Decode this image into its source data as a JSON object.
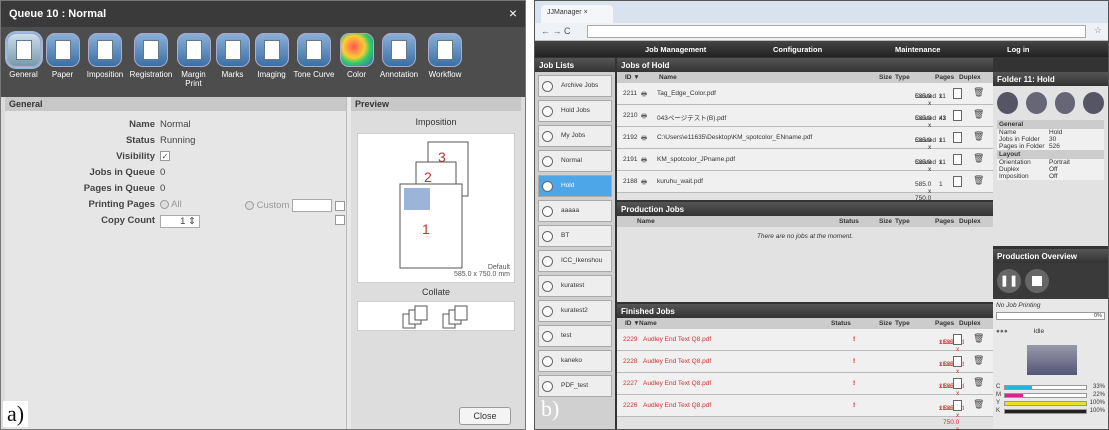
{
  "labels": {
    "a": "a)",
    "b": "b)"
  },
  "dialog": {
    "title": "Queue 10 : Normal",
    "close_x": "×",
    "tools": [
      "General",
      "Paper",
      "Imposition",
      "Registration",
      "Margin Print",
      "Marks",
      "Imaging",
      "Tone Curve",
      "Color",
      "Annotation",
      "Workflow"
    ],
    "general_header": "General",
    "preview_header": "Preview",
    "fields": [
      {
        "k": "Name",
        "v": "Normal"
      },
      {
        "k": "Status",
        "v": "Running"
      },
      {
        "k": "Visibility",
        "v": ""
      },
      {
        "k": "Jobs in Queue",
        "v": "0"
      },
      {
        "k": "Pages in Queue",
        "v": "0"
      },
      {
        "k": "Printing Pages",
        "v": "All"
      },
      {
        "k": "Copy Count",
        "v": "1"
      }
    ],
    "custom_label": "Custom",
    "imposition_label": "Imposition",
    "default_label": "Default",
    "size_label": "585.0 x 750.0 mm",
    "collate_label": "Collate",
    "close_button": "Close"
  },
  "app": {
    "tab_title": "JJManager",
    "nav": [
      "Job Management",
      "Configuration",
      "Maintenance",
      "Log in"
    ],
    "job_lists_header": "Job Lists",
    "job_lists": [
      "Archive Jobs",
      "Hold Jobs",
      "My Jobs",
      "Normal",
      "Hold",
      "aaaaa",
      "BT",
      "ICC_Ikenshou",
      "kuratest",
      "kuratest2",
      "test",
      "kaneko",
      "PDF_test"
    ],
    "hold_header": "Jobs of Hold",
    "hold_cols": [
      "ID ▼",
      "Name",
      "Size",
      "Type",
      "Pages",
      "Duplex"
    ],
    "hold_rows": [
      {
        "id": "2211",
        "name": "Tag_Edge_Color.pdf",
        "size": "585.0 x 750.0 x 0.13",
        "type": "Coated",
        "pages": "1",
        "copies": "x1"
      },
      {
        "id": "2210",
        "name": "043ページテスト(B).pdf",
        "size": "585.0 x 750.0 x 0.13",
        "type": "Coated",
        "pages": "43",
        "copies": "x1"
      },
      {
        "id": "2192",
        "name": "C:\\Users\\e11635\\Desktop\\KM_spotcolor_ENname.pdf",
        "size": "585.0 x 750.0 x 0.13",
        "type": "Coated",
        "pages": "1",
        "copies": "x1"
      },
      {
        "id": "2191",
        "name": "KM_spotcolor_JPname.pdf",
        "size": "585.0 x 750.0 x 0.10",
        "type": "Coated",
        "pages": "1",
        "copies": "x1"
      },
      {
        "id": "2188",
        "name": "kuruhu_wait.pdf",
        "size": "585.0 x 750.0 x 0.13",
        "type": "",
        "pages": "1",
        "copies": ""
      }
    ],
    "prod_header": "Production Jobs",
    "prod_cols": [
      "Name",
      "Status",
      "Size",
      "Type",
      "Pages",
      "Duplex"
    ],
    "prod_empty": "There are no jobs at the moment.",
    "fin_header": "Finished Jobs",
    "fin_cols": [
      "ID ▼",
      "Name",
      "Status",
      "Size",
      "Type",
      "Pages",
      "Duplex"
    ],
    "fin_rows": [
      {
        "id": "2229",
        "name": "Audley End Text Q8.pdf",
        "size": "585.0 x 750.0 x 0.10",
        "type": "Coated",
        "pages": "1",
        "copies": "x1"
      },
      {
        "id": "2228",
        "name": "Audley End Text Q8.pdf",
        "size": "585.0 x 750.0 x 0.10",
        "type": "Coated",
        "pages": "1",
        "copies": "x1"
      },
      {
        "id": "2227",
        "name": "Audley End Text Q8.pdf",
        "size": "585.0 x 750.0 x 0.10",
        "type": "Coated",
        "pages": "1",
        "copies": "x1"
      },
      {
        "id": "2226",
        "name": "Audley End Text Q8.pdf",
        "size": "585.0 x 750.0 x 0.10",
        "type": "Coated",
        "pages": "1",
        "copies": "x1"
      }
    ],
    "folder_header": "Folder 11: Hold",
    "folder_info": {
      "sec1": "General",
      "rows1": [
        [
          "Name",
          "Hold"
        ],
        [
          "Jobs in Folder",
          "30"
        ],
        [
          "Pages in Folder",
          "526"
        ]
      ],
      "sec2": "Layout",
      "rows2": [
        [
          "Orientation",
          "Portrait"
        ],
        [
          "Duplex",
          "Off"
        ],
        [
          "Imposition",
          "Off"
        ]
      ]
    },
    "overview_header": "Production Overview",
    "no_job": "No Job Printing",
    "progress": "0%",
    "idle": "Idle",
    "toner": [
      {
        "c": "C",
        "pct": "33%",
        "v": 0.33,
        "color": "#22b5d8"
      },
      {
        "c": "M",
        "pct": "22%",
        "v": 0.22,
        "color": "#d8228a"
      },
      {
        "c": "Y",
        "pct": "100%",
        "v": 1.0,
        "color": "#e8e022"
      },
      {
        "c": "K",
        "pct": "100%",
        "v": 1.0,
        "color": "#222222"
      }
    ]
  }
}
